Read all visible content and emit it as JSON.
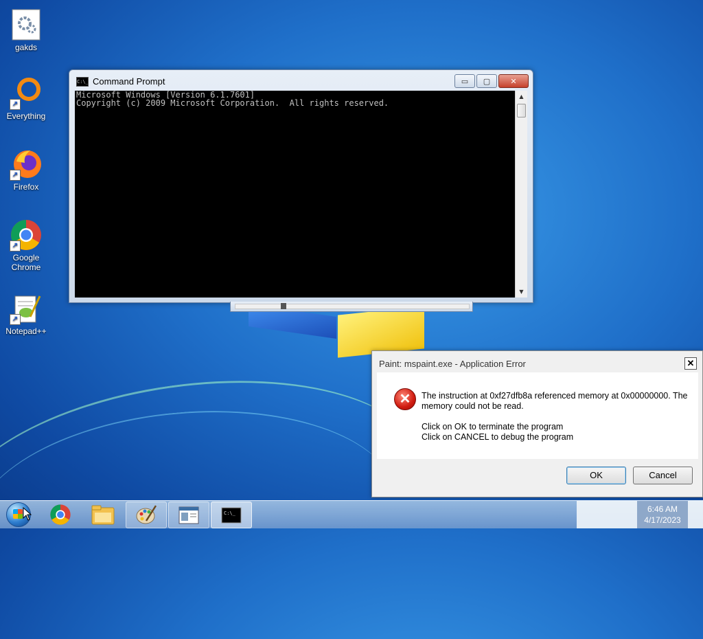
{
  "desktop": {
    "icons": [
      {
        "label": "gakds",
        "icon": "gear-file-icon"
      },
      {
        "label": "Everything",
        "icon": "everything-icon"
      },
      {
        "label": "Firefox",
        "icon": "firefox-icon"
      },
      {
        "label": "Google Chrome",
        "icon": "chrome-icon"
      },
      {
        "label": "Notepad++",
        "icon": "notepadpp-icon"
      }
    ]
  },
  "cmd": {
    "title": "Command Prompt",
    "icon_text": "C:\\_",
    "lines": [
      "Microsoft Windows [Version 6.1.7601]",
      "Copyright (c) 2009 Microsoft Corporation.  All rights reserved."
    ],
    "buttons": {
      "minimize": "▭",
      "maximize": "▢",
      "close": "✕"
    }
  },
  "dialog": {
    "title": "Paint: mspaint.exe - Application Error",
    "close": "✕",
    "message_line1": "The instruction at 0xf27dfb8a referenced memory at 0x00000000. The",
    "message_line2": "memory could not be read.",
    "instruction_line1": "Click on OK to terminate the program",
    "instruction_line2": "Click on CANCEL to debug the program",
    "ok_label": "OK",
    "cancel_label": "Cancel"
  },
  "taskbar": {
    "items": [
      {
        "name": "chrome",
        "icon": "chrome-icon"
      },
      {
        "name": "explorer",
        "icon": "folder-icon"
      },
      {
        "name": "paint",
        "icon": "paint-palette-icon"
      },
      {
        "name": "error-window",
        "icon": "window-icon"
      },
      {
        "name": "cmd",
        "icon": "cmd-icon"
      }
    ],
    "clock_time": "6:46 AM",
    "clock_date": "4/17/2023"
  }
}
